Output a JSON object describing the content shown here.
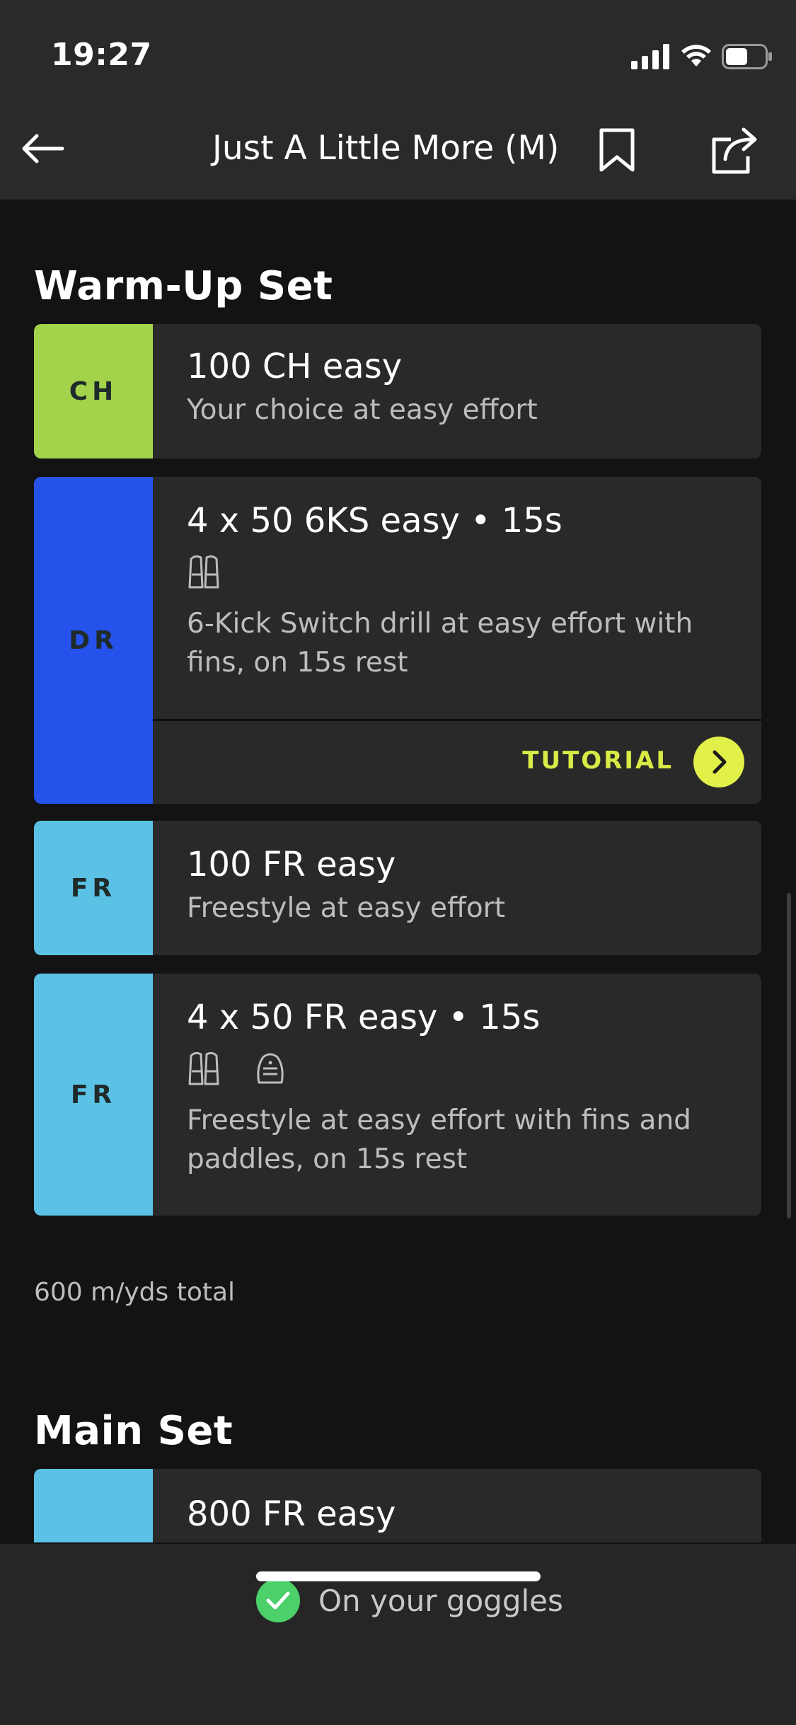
{
  "status": {
    "time": "19:27"
  },
  "nav": {
    "title": "Just A Little More (M)"
  },
  "colors": {
    "choice": "#a2d34a",
    "drill": "#2652ec",
    "freestyle": "#5bc2e5",
    "accent": "#e2f04a",
    "success": "#4cd06a"
  },
  "warmup": {
    "title": "Warm-Up Set",
    "items": [
      {
        "stroke": "CH",
        "title": "100 CH easy",
        "desc": "Your choice at easy effort"
      },
      {
        "stroke": "DR",
        "title": "4 x 50 6KS easy • 15s",
        "equipment": [
          "fins-icon"
        ],
        "desc": "6-Kick Switch drill at easy effort with fins, on 15s rest",
        "tutorial": "TUTORIAL"
      },
      {
        "stroke": "FR",
        "title": "100 FR easy",
        "desc": "Freestyle at easy effort"
      },
      {
        "stroke": "FR",
        "title": "4 x 50 FR easy • 15s",
        "equipment": [
          "fins-icon",
          "paddles-icon"
        ],
        "desc": "Freestyle at easy effort with fins and paddles, on 15s rest"
      }
    ],
    "total": "600 m/yds total"
  },
  "main": {
    "title": "Main Set",
    "items": [
      {
        "title": "800 FR easy"
      }
    ]
  },
  "footer": {
    "goggles_label": "On your goggles"
  }
}
